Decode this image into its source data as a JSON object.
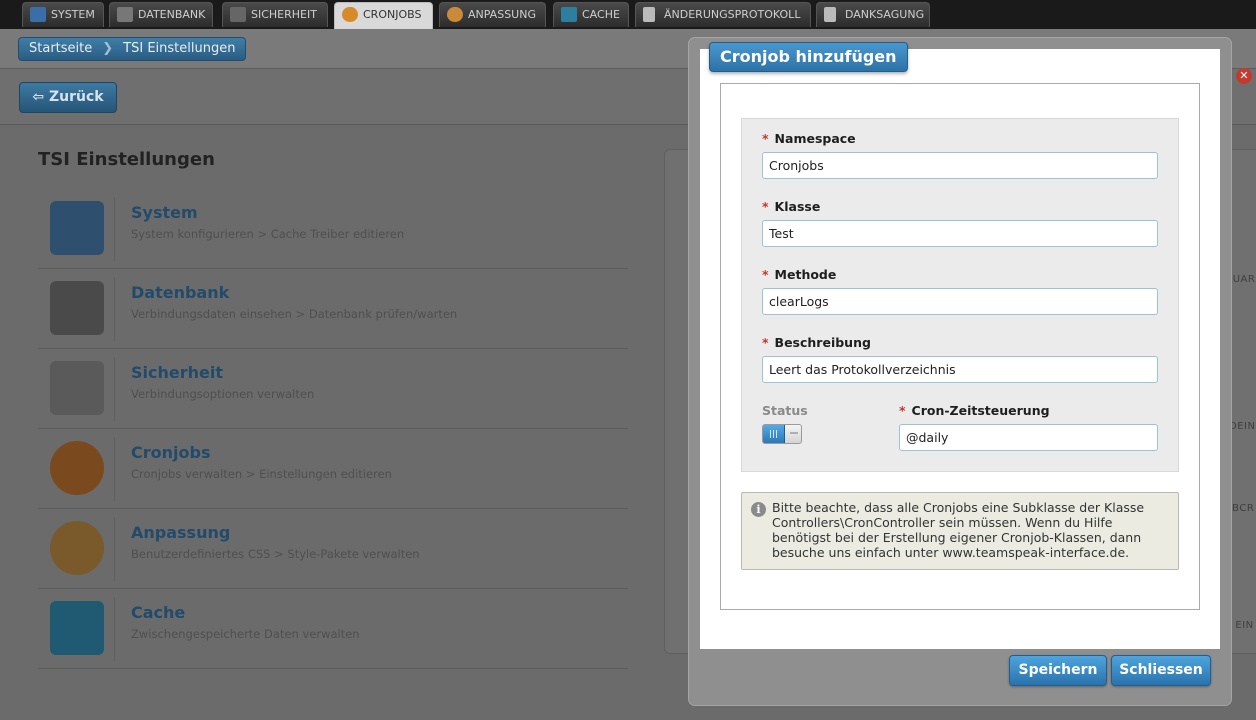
{
  "nav": {
    "tabs": [
      {
        "label": "SYSTEM",
        "icon": "monitor-icon",
        "active": false
      },
      {
        "label": "DATENBANK",
        "icon": "database-icon",
        "active": false
      },
      {
        "label": "SICHERHEIT",
        "icon": "safe-icon",
        "active": false
      },
      {
        "label": "CRONJOBS",
        "icon": "clock-icon",
        "active": true
      },
      {
        "label": "ANPASSUNG",
        "icon": "palette-icon",
        "active": false
      },
      {
        "label": "CACHE",
        "icon": "basket-icon",
        "active": false
      },
      {
        "label": "ÄNDERUNGSPROTOKOLL",
        "icon": "document-icon",
        "active": false
      },
      {
        "label": "DANKSAGUNG",
        "icon": "document-icon",
        "active": false
      }
    ]
  },
  "breadcrumb": {
    "home": "Startseite",
    "current": "TSI Einstellungen"
  },
  "back_button": "⇦ Zurück",
  "page_title": "TSI Einstellungen",
  "items": [
    {
      "title": "System",
      "sub": "System konfigurieren > Cache Treiber editieren",
      "icon": "monitor-icon"
    },
    {
      "title": "Datenbank",
      "sub": "Verbindungsdaten einsehen > Datenbank prüfen/warten",
      "icon": "database-icon"
    },
    {
      "title": "Sicherheit",
      "sub": "Verbindungsoptionen verwalten",
      "icon": "safe-icon"
    },
    {
      "title": "Cronjobs",
      "sub": "Cronjobs verwalten > Einstellungen editieren",
      "icon": "clock-icon"
    },
    {
      "title": "Anpassung",
      "sub": "Benutzerdefiniertes CSS > Style-Pakete verwalten",
      "icon": "palette-icon"
    },
    {
      "title": "Cache",
      "sub": "Zwischengespeicherte Daten verwalten",
      "icon": "basket-icon"
    }
  ],
  "right_fragments": {
    "a": "BZUAR",
    "b": "B DEIN",
    "c": "VEBCR",
    "d": "SS EIN"
  },
  "modal": {
    "title": "Cronjob hinzufügen",
    "required_mark": "*",
    "fields": {
      "namespace": {
        "label": "Namespace",
        "value": "Cronjobs"
      },
      "klasse": {
        "label": "Klasse",
        "value": "Test"
      },
      "methode": {
        "label": "Methode",
        "value": "clearLogs"
      },
      "beschreibung": {
        "label": "Beschreibung",
        "value": "Leert das Protokollverzeichnis"
      },
      "cron": {
        "label": "Cron-Zeitsteuerung",
        "value": "@daily"
      },
      "status": {
        "label": "Status",
        "enabled": true
      }
    },
    "info_icon": "i",
    "info_text": "Bitte beachte, dass alle Cronjobs eine Subklasse der Klasse Controllers\\CronController sein müssen. Wenn du Hilfe benötigst bei der Erstellung eigener Cronjob-Klassen, dann besuche uns einfach unter www.teamspeak-interface.de.",
    "save_button": "Speichern",
    "close_button": "Schliessen"
  },
  "colors": {
    "accent": "#2c72a6",
    "required": "#c0392b",
    "overlay": "#6b6b6b"
  }
}
